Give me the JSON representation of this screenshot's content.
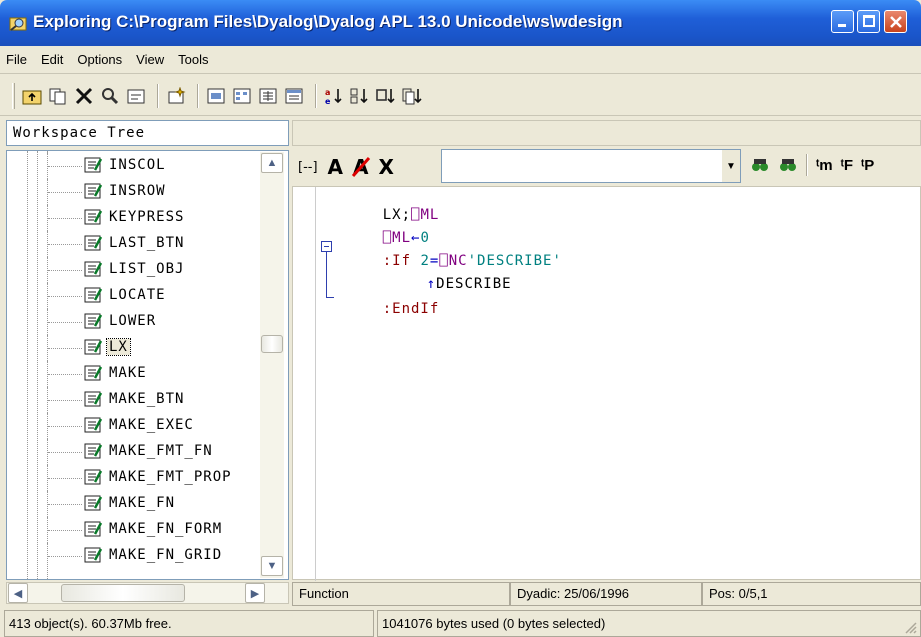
{
  "window": {
    "title": "Exploring C:\\Program Files\\Dyalog\\Dyalog APL 13.0 Unicode\\ws\\wdesign"
  },
  "menu": [
    "File",
    "Edit",
    "Options",
    "View",
    "Tools"
  ],
  "toolbar_icons": [
    "up-folder-icon",
    "copy-icon",
    "delete-icon",
    "find-icon",
    "properties-icon",
    "new-object-icon",
    "large-icons-view-icon",
    "small-icons-view-icon",
    "list-view-icon",
    "details-view-icon",
    "sort-by-name-icon",
    "sort-by-type-icon",
    "sort-by-date-icon",
    "sort-by-size-icon"
  ],
  "workspace_tree": {
    "header": "Workspace Tree",
    "items": [
      "INSCOL",
      "INSROW",
      "KEYPRESS",
      "LAST_BTN",
      "LIST_OBJ",
      "LOCATE",
      "LOWER",
      "LX",
      "MAKE",
      "MAKE_BTN",
      "MAKE_EXEC",
      "MAKE_FMT_FN",
      "MAKE_FMT_PROP",
      "MAKE_FN",
      "MAKE_FN_FORM",
      "MAKE_FN_GRID"
    ],
    "selected": "LX"
  },
  "editor_toolbar": {
    "buttons": [
      "[--]",
      "A",
      "A",
      "X"
    ],
    "right_icons": [
      "find-icon",
      "find-next-icon",
      "new-method-icon",
      "new-function-icon",
      "new-property-icon"
    ],
    "right_labels": [
      "ᵗm",
      "ᵗF",
      "ᵗP"
    ],
    "search_value": ""
  },
  "code": {
    "line1": {
      "a": "LX;",
      "b": "⎕ML"
    },
    "line2": {
      "a": "⎕ML",
      "b": "←",
      "c": "0"
    },
    "line3": {
      "a": ":If ",
      "b": "2",
      "c": "=",
      "d": "⎕NC",
      "e": "'DESCRIBE'"
    },
    "line4": {
      "a": "↑",
      "b": "DESCRIBE"
    },
    "line5": {
      "a": ":EndIf"
    }
  },
  "status": {
    "type": "Function",
    "dyadic": "Dyadic: 25/06/1996",
    "pos": "Pos: 0/5,1",
    "objects": "413 object(s). 60.37Mb free.",
    "bytes": "1041076 bytes used (0 bytes selected)"
  },
  "colors": {
    "title_bar": "#1f5fd8",
    "keyword": "#8b0000",
    "system_name": "#800080",
    "string": "#008080"
  }
}
